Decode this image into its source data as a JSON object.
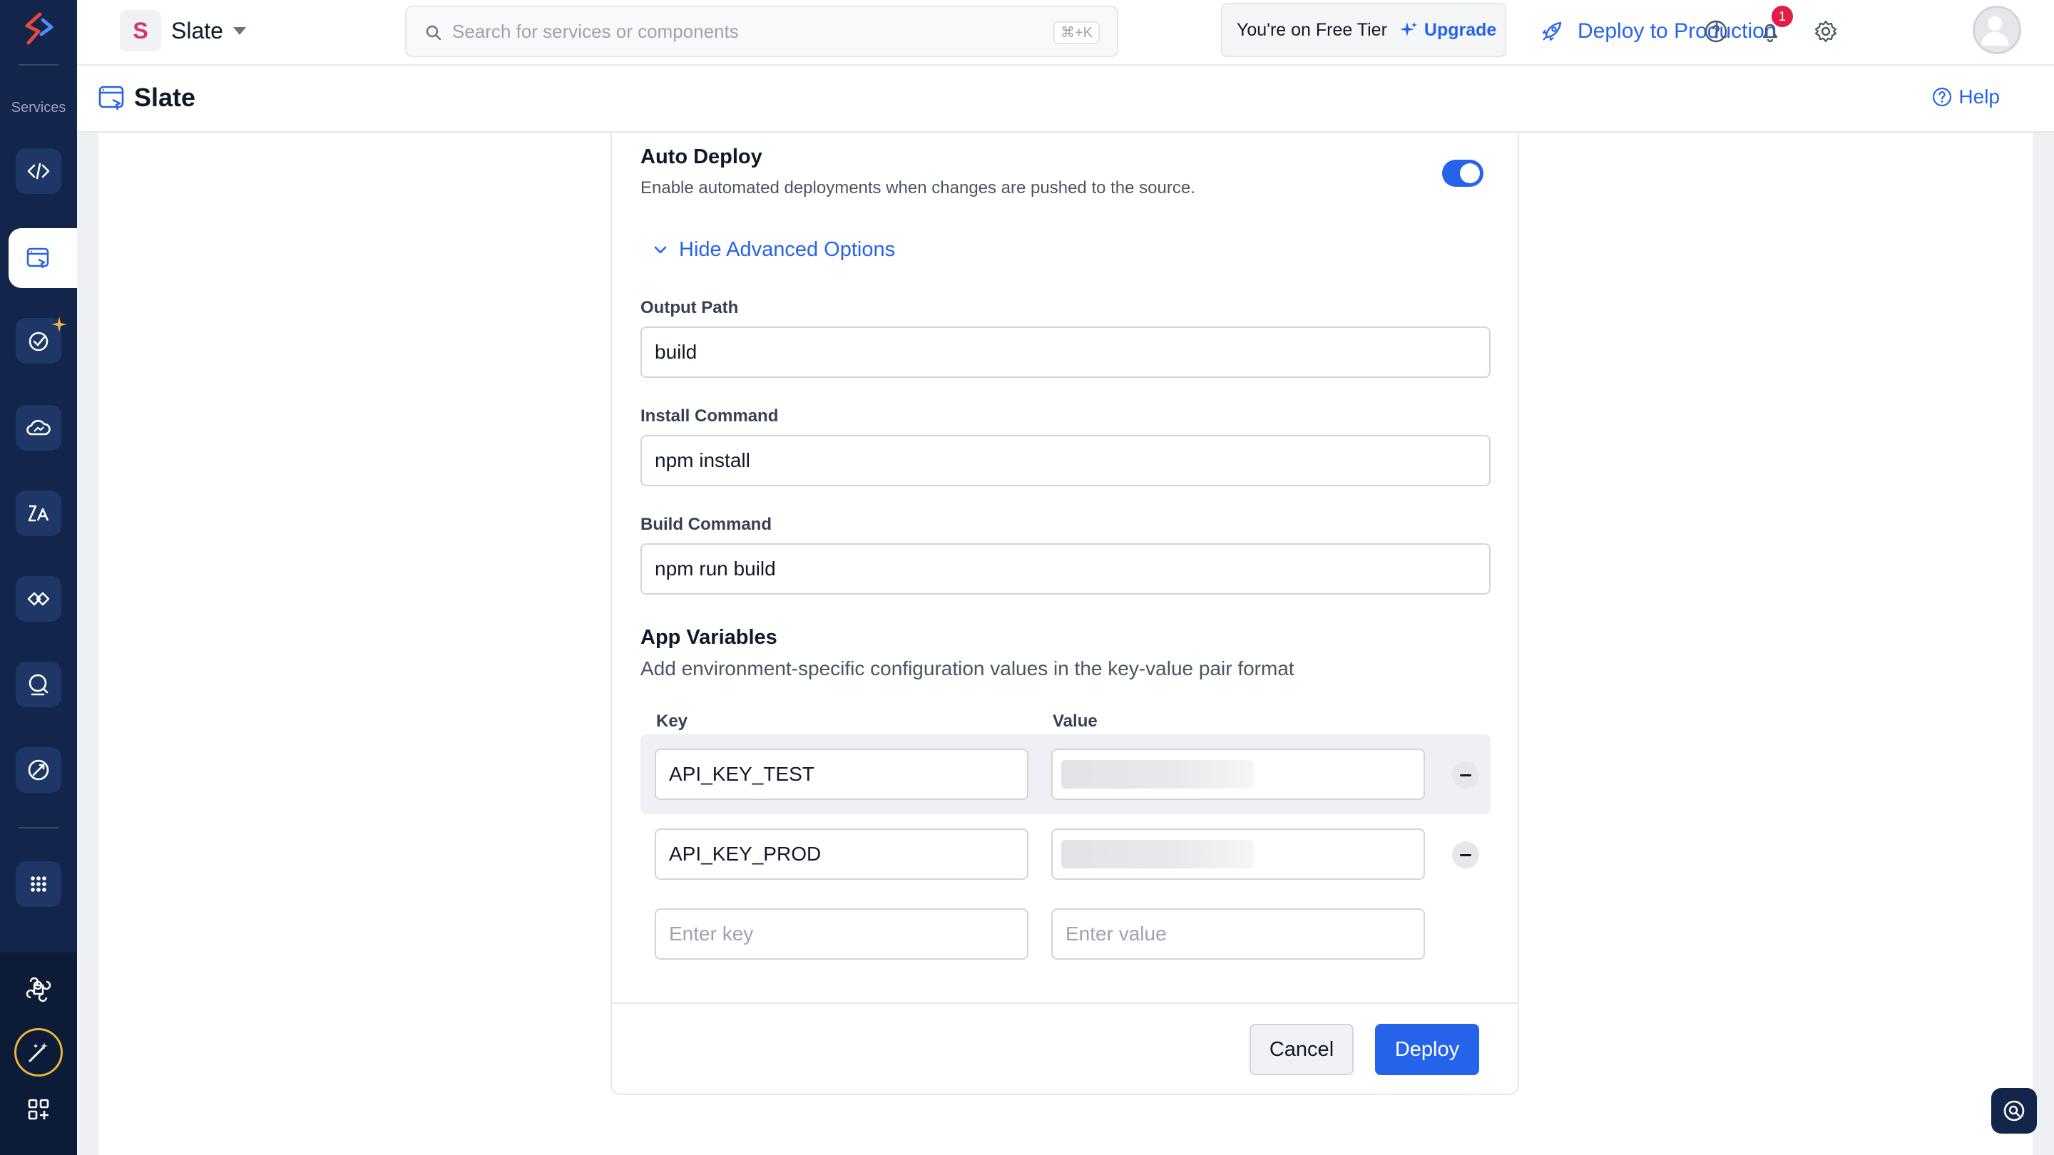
{
  "rail": {
    "services_label": "Services",
    "items": [
      "code-service-icon",
      "slate-icon",
      "quality-check-icon",
      "cloud-icon",
      "analytics-icon",
      "integration-icon",
      "search-service-icon",
      "rocket-icon",
      "apps-grid-icon"
    ],
    "bottom": [
      "command-icon",
      "magic-wand-icon",
      "add-widget-icon"
    ],
    "colors": {
      "rail_bg": "#13254a",
      "accent_ring": "#e8b53a"
    }
  },
  "topbar": {
    "app_initial": "S",
    "app_name": "Slate",
    "search_placeholder": "Search for services or components",
    "search_shortcut": "⌘+K",
    "tier_text": "You're on Free Tier",
    "upgrade_label": "Upgrade",
    "deploy_prod_label": "Deploy to Production",
    "notification_count": "1"
  },
  "header": {
    "title": "Slate",
    "help_label": "Help"
  },
  "form": {
    "auto_deploy": {
      "title": "Auto Deploy",
      "description": "Enable automated deployments when changes are pushed to the source.",
      "enabled": true
    },
    "advanced_toggle_label": "Hide Advanced Options",
    "output_path": {
      "label": "Output Path",
      "value": "build"
    },
    "install_command": {
      "label": "Install Command",
      "value": "npm install"
    },
    "build_command": {
      "label": "Build Command",
      "value": "npm run build"
    },
    "app_variables": {
      "title": "App Variables",
      "description": "Add environment-specific configuration values in the key-value pair format",
      "key_header": "Key",
      "value_header": "Value",
      "rows": [
        {
          "key": "API_KEY_TEST",
          "value_masked": true
        },
        {
          "key": "API_KEY_PROD",
          "value_masked": true
        }
      ],
      "new_key_placeholder": "Enter key",
      "new_value_placeholder": "Enter value"
    },
    "cancel_label": "Cancel",
    "deploy_label": "Deploy",
    "accent_color": "#2563eb"
  }
}
